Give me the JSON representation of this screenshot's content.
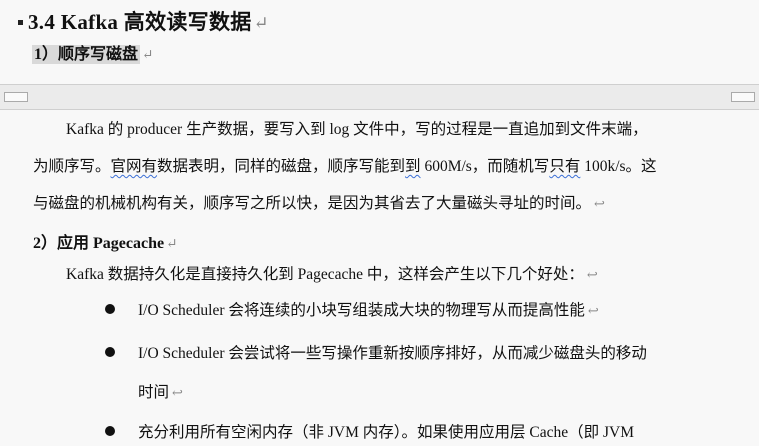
{
  "heading": {
    "number": "3.4",
    "text": "Kafka 高效读写数据"
  },
  "section1": {
    "title": "1）顺序写磁盘"
  },
  "paragraph1": {
    "line1": "Kafka 的 producer 生产数据，要写入到 log 文件中，写的过程是一直追加到文件末端，",
    "line2_a": "为顺序写。",
    "line2_b": "官网有",
    "line2_c": "数据表明，同样的磁盘，顺序写能到",
    "line2_d": "到",
    "line2_e": " 600M/s，而随机写",
    "line2_f": "只有",
    "line2_g": " 100k/s。这",
    "line3": "与磁盘的机械机构有关，顺序写之所以快，是因为其省去了大量磁头寻址的时间。"
  },
  "section2": {
    "title": "2）应用 Pagecache"
  },
  "paragraph2": {
    "intro": "Kafka 数据持久化是直接持久化到 Pagecache 中，这样会产生以下几个好处：",
    "bullets": [
      "I/O Scheduler  会将连续的小块写组装成大块的物理写从而提高性能",
      "I/O Scheduler  会尝试将一些写操作重新按顺序排好，从而减少磁盘头的移动",
      "时间",
      "充分利用所有空闲内存（非  JVM  内存）。如果使用应用层  Cache（即  JVM"
    ]
  },
  "marks": {
    "pilcrow": "↵",
    "return": "↩"
  }
}
